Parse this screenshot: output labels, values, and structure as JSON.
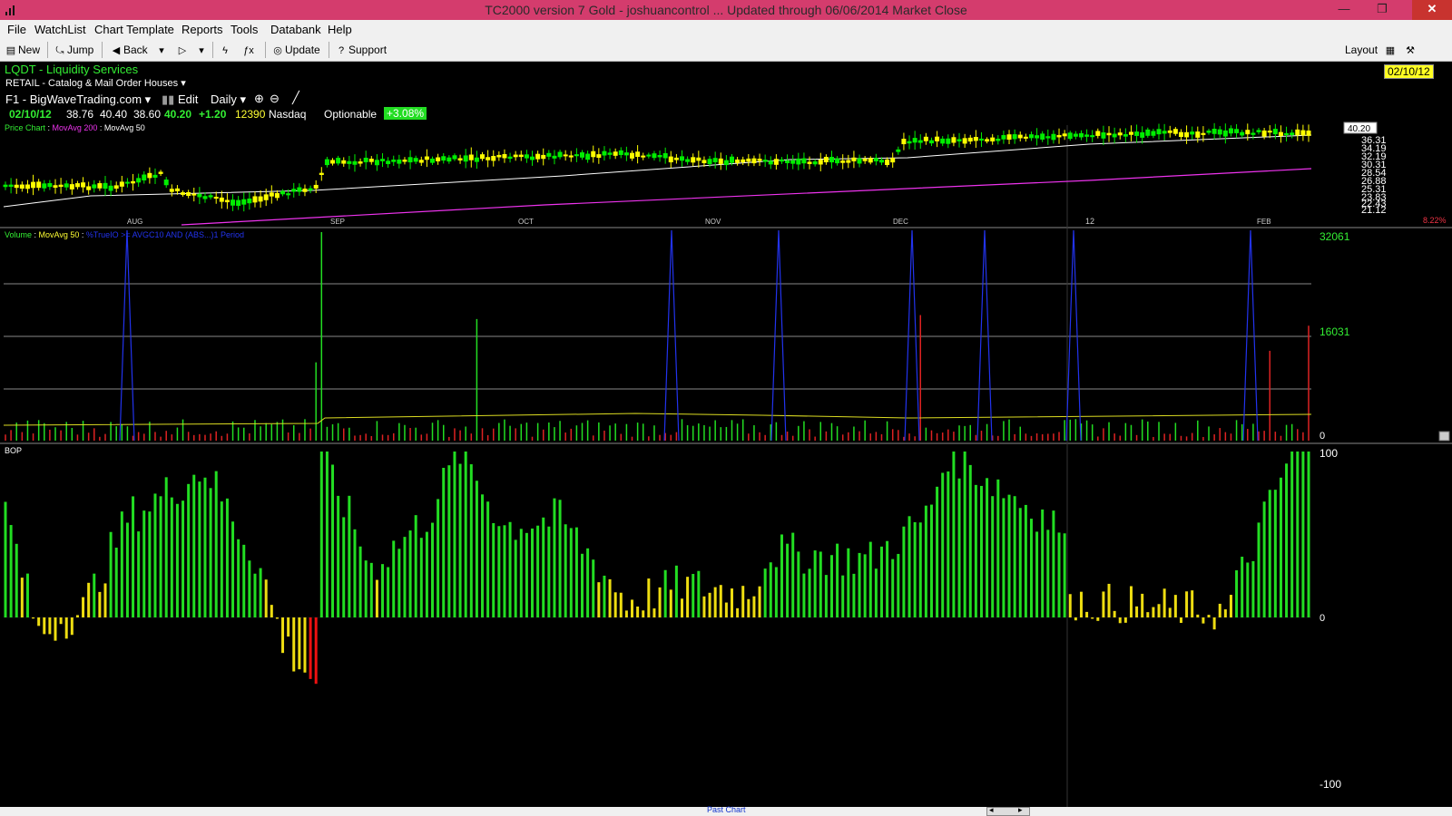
{
  "window": {
    "title": "TC2000 version 7 Gold - joshuancontrol  ... Updated through 06/06/2014  Market Close",
    "minimize": "—",
    "restore": "❐",
    "close": "✕"
  },
  "menu": [
    "File",
    "WatchList",
    "Chart Template",
    "Reports",
    "Tools",
    "Databank",
    "Help"
  ],
  "toolbar": {
    "new": "New",
    "jump": "Jump",
    "back": "Back",
    "update": "Update",
    "support": "Support",
    "layout": "Layout"
  },
  "symbol": {
    "ticker_name": "LQDT - Liquidity Services",
    "industry": "RETAIL - Catalog & Mail Order Houses",
    "template": "F1 - BigWaveTrading.com",
    "edit": "Edit",
    "period": "Daily",
    "date": "02/10/12",
    "open": "38.76",
    "high": "40.40",
    "low": "38.60",
    "close": "40.20",
    "change": "+1.20",
    "volume": "12390",
    "exchange": "Nasdaq",
    "optionable": "Optionable",
    "pct_change": "+3.08%",
    "date_badge": "02/10/12"
  },
  "price_pane": {
    "label_main": "Price Chart",
    "label_ma200": "MovAvg 200",
    "label_ma50": "MovAvg 50",
    "last_price": "40.20",
    "y_ticks": [
      "36.31",
      "34.19",
      "32.19",
      "30.31",
      "28.54",
      "26.88",
      "25.31",
      "23.83",
      "22.43",
      "21.12"
    ],
    "pct_label": "8.22%",
    "months": [
      "AUG",
      "SEP",
      "OCT",
      "NOV",
      "DEC",
      "12",
      "FEB"
    ],
    "colors": {
      "up": "#00ee00",
      "down": "#ffff00",
      "ma50": "#ffffff",
      "ma200": "#ee33ee"
    }
  },
  "volume_pane": {
    "label_volume": "Volume",
    "label_ma50": "MovAvg 50",
    "label_pcf": "%TrueIO >= AVGC10 AND (ABS...)1 Period",
    "y_ticks": [
      "32061",
      "16031",
      "0"
    ]
  },
  "bop_pane": {
    "label": "BOP",
    "y_ticks": [
      "100",
      "0",
      "-100"
    ]
  },
  "status": {
    "past_chart": "Past Chart"
  }
}
